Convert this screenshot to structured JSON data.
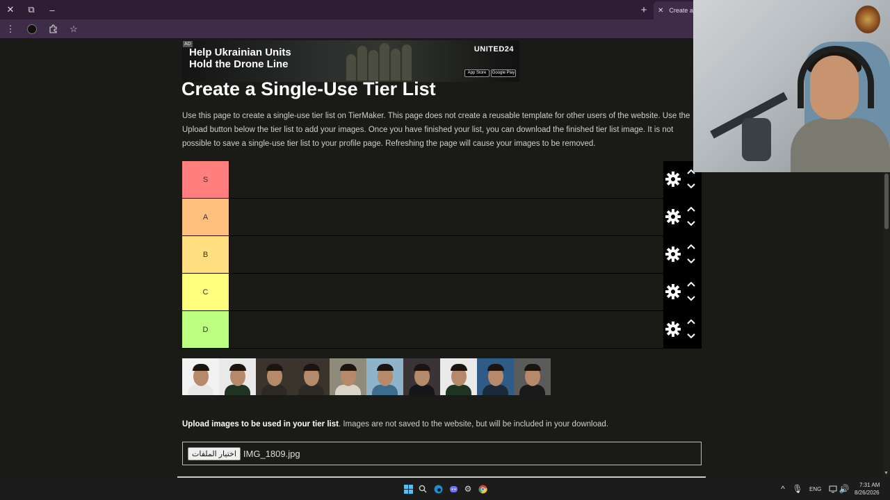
{
  "browser": {
    "tab_title": "Create a S",
    "new_tab_symbol": "+",
    "close_symbol": "✕"
  },
  "ad": {
    "tag": "AD",
    "headline": "Help Ukrainian Units Hold the Drone Line",
    "brand": "UNITED24",
    "app_store": "App Store",
    "google_play": "Google Play"
  },
  "page": {
    "title": "Create a Single-Use Tier List",
    "intro": "Use this page to create a single-use tier list on TierMaker. This page does not create a reusable template for other users of the website. Use the Upload button below the tier list to add your images. Once you have finished your list, you can download the finished tier list image. It is not possible to save a single-use tier list to your profile page. Refreshing the page will cause your images to be removed."
  },
  "tiers": [
    {
      "label": "S",
      "color": "#ff7f7f"
    },
    {
      "label": "A",
      "color": "#ffbf7f"
    },
    {
      "label": "B",
      "color": "#ffdf7f"
    },
    {
      "label": "C",
      "color": "#ffff7f"
    },
    {
      "label": "D",
      "color": "#bfff7f"
    }
  ],
  "pool_images": [
    {
      "shirt": "#e8e8e8",
      "bg": "#f2f2f2",
      "icon": "person-photo-icon"
    },
    {
      "shirt": "#1f3322",
      "bg": "#e9e9e9",
      "icon": "person-photo-icon"
    },
    {
      "shirt": "#2d2a26",
      "bg": "#3b342c",
      "icon": "person-photo-icon"
    },
    {
      "shirt": "#2d2a26",
      "bg": "#3b342c",
      "icon": "person-photo-icon"
    },
    {
      "shirt": "#d9d4c5",
      "bg": "#8f8b7c",
      "icon": "person-photo-icon"
    },
    {
      "shirt": "#3d6d8c",
      "bg": "#8fb4c9",
      "icon": "person-photo-icon"
    },
    {
      "shirt": "#15161a",
      "bg": "#3b3436",
      "icon": "person-photo-icon"
    },
    {
      "shirt": "#1f3322",
      "bg": "#e9e9e9",
      "icon": "person-photo-icon"
    },
    {
      "shirt": "#1b2a3b",
      "bg": "#2f5c86",
      "icon": "person-photo-icon"
    },
    {
      "shirt": "#1a1a1a",
      "bg": "#5b5b5b",
      "icon": "person-photo-icon"
    }
  ],
  "upload": {
    "bold": "Upload images to be used in your tier list",
    "rest": ". Images are not saved to the website, but will be included in your download.",
    "button": "اختيار الملفات",
    "file_name": "IMG_1809.jpg"
  },
  "tray": {
    "lang": "ENG",
    "time": "7:31 AM",
    "date": "8/26/2026"
  }
}
